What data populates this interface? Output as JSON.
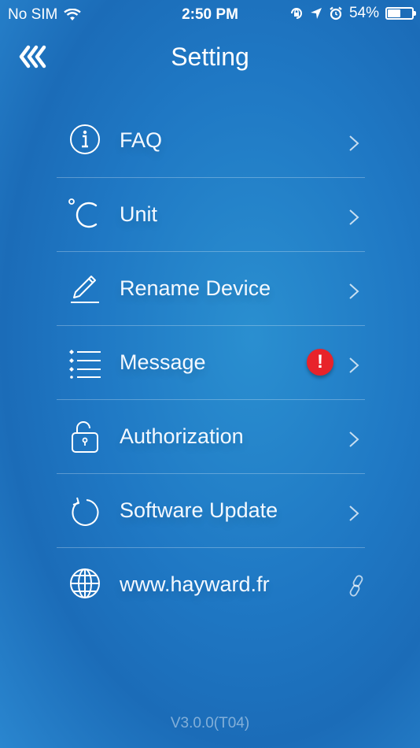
{
  "status_bar": {
    "carrier": "No SIM",
    "time": "2:50 PM",
    "battery_percent": "54%",
    "battery_level": 0.54,
    "icons": [
      "wifi-icon",
      "orientation-lock-icon",
      "location-icon",
      "alarm-icon",
      "battery-icon"
    ]
  },
  "header": {
    "title": "Setting",
    "back_icon": "triple-chevron-left-icon"
  },
  "menu": {
    "items": [
      {
        "label": "FAQ",
        "icon": "info-icon"
      },
      {
        "label": "Unit",
        "icon": "celsius-icon"
      },
      {
        "label": "Rename Device",
        "icon": "pencil-icon"
      },
      {
        "label": "Message",
        "icon": "list-icon",
        "badge": "!"
      },
      {
        "label": "Authorization",
        "icon": "unlock-icon"
      },
      {
        "label": "Software Update",
        "icon": "refresh-icon"
      },
      {
        "label": "www.hayward.fr",
        "icon": "globe-icon",
        "trailing_icon": "link-icon"
      }
    ]
  },
  "footer": {
    "version": "V3.0.0(T04)"
  },
  "colors": {
    "background": "#1f78c4",
    "badge": "#e8232a",
    "text": "#ffffff"
  }
}
